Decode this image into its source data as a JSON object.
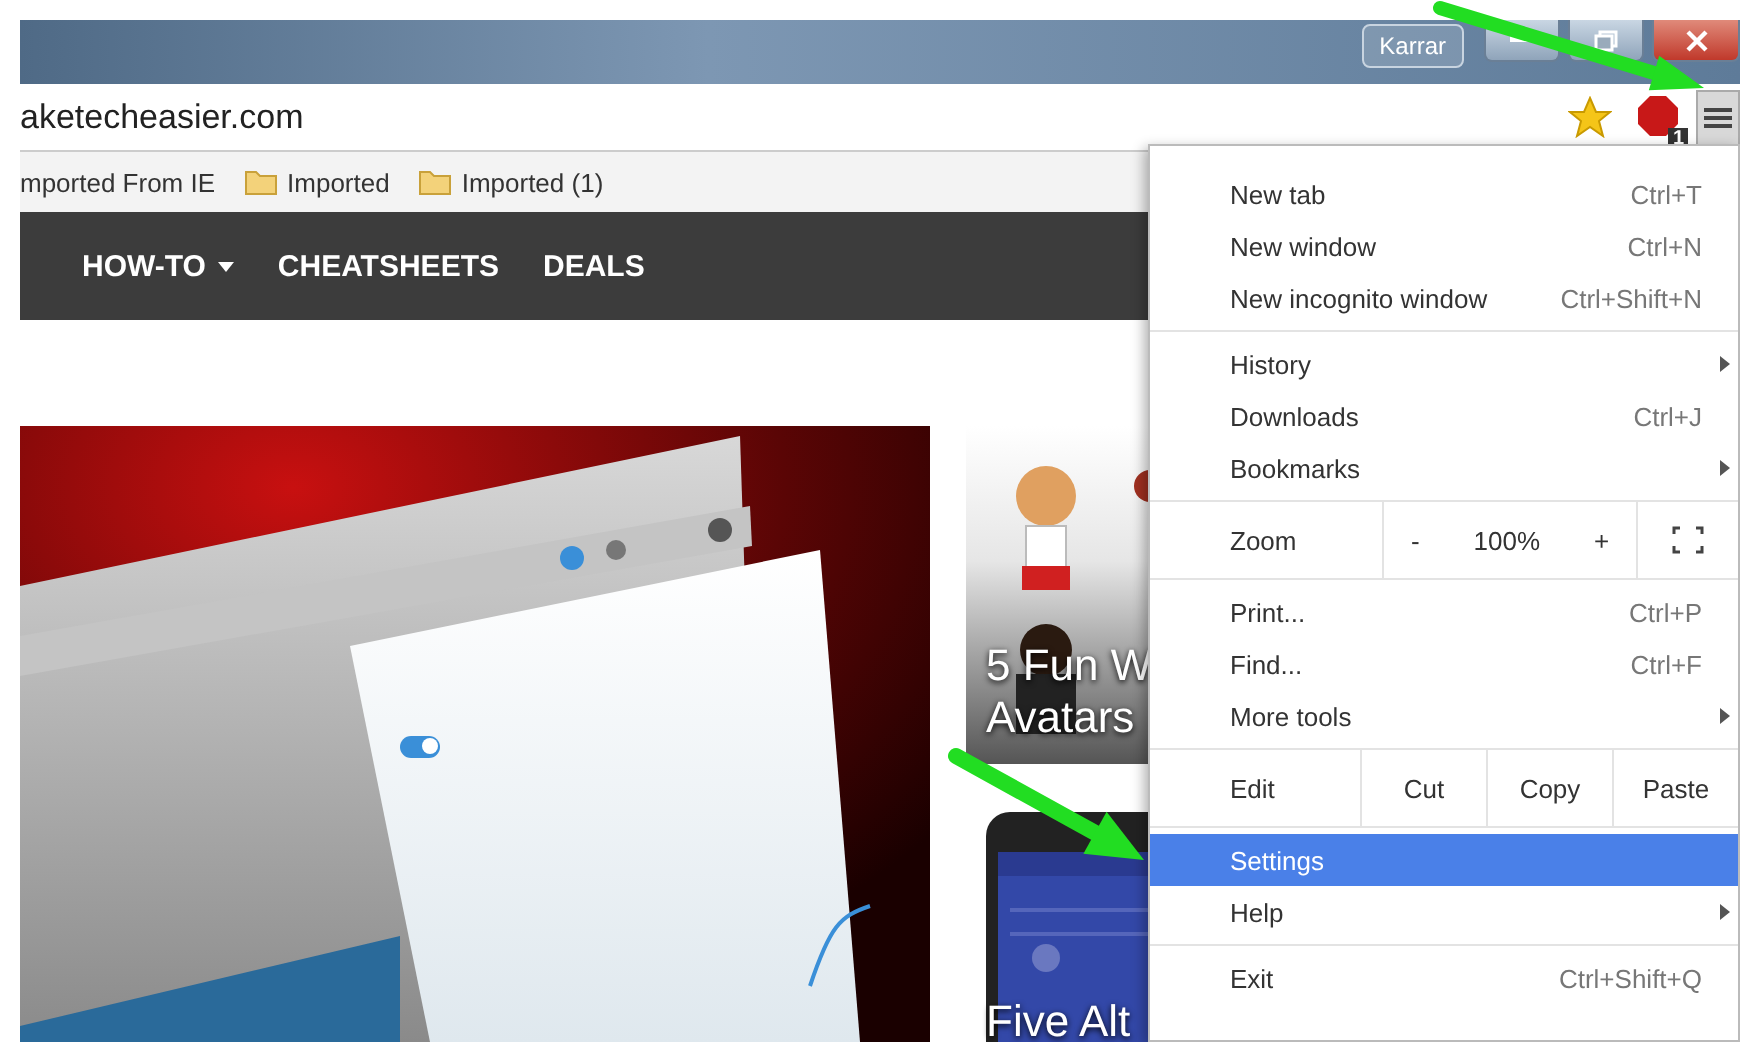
{
  "title_bar": {
    "user_button": "Karrar"
  },
  "address_bar": {
    "url": "aketecheasier.com",
    "extension_badge": "1",
    "menu_open": true
  },
  "bookmarks": [
    {
      "kind": "text",
      "label": "mported From IE"
    },
    {
      "kind": "folder",
      "label": "Imported"
    },
    {
      "kind": "folder",
      "label": "Imported (1)"
    }
  ],
  "nav": [
    {
      "label": "HOW-TO",
      "dropdown": true
    },
    {
      "label": "CHEATSHEETS",
      "dropdown": false
    },
    {
      "label": "DEALS",
      "dropdown": false
    }
  ],
  "tiles": [
    {
      "kind": "avatars",
      "headline": [
        "5 Fun W",
        "Avatars"
      ]
    },
    {
      "kind": "phone",
      "headline": [
        "Five Alt"
      ]
    }
  ],
  "menu": {
    "sections": [
      [
        {
          "kind": "item",
          "label": "New tab",
          "shortcut": "Ctrl+T",
          "submenu": false,
          "selected": false
        },
        {
          "kind": "item",
          "label": "New window",
          "shortcut": "Ctrl+N",
          "submenu": false,
          "selected": false
        },
        {
          "kind": "item",
          "label": "New incognito window",
          "shortcut": "Ctrl+Shift+N",
          "submenu": false,
          "selected": false
        }
      ],
      [
        {
          "kind": "item",
          "label": "History",
          "submenu": true,
          "selected": false
        },
        {
          "kind": "item",
          "label": "Downloads",
          "shortcut": "Ctrl+J",
          "submenu": false,
          "selected": false
        },
        {
          "kind": "item",
          "label": "Bookmarks",
          "submenu": true,
          "selected": false
        }
      ],
      [
        {
          "kind": "zoom",
          "label": "Zoom",
          "minus": "-",
          "value": "100%",
          "plus": "+"
        }
      ],
      [
        {
          "kind": "item",
          "label": "Print...",
          "shortcut": "Ctrl+P",
          "submenu": false,
          "selected": false
        },
        {
          "kind": "item",
          "label": "Find...",
          "shortcut": "Ctrl+F",
          "submenu": false,
          "selected": false
        },
        {
          "kind": "item",
          "label": "More tools",
          "submenu": true,
          "selected": false
        }
      ],
      [
        {
          "kind": "edit",
          "label": "Edit",
          "actions": [
            "Cut",
            "Copy",
            "Paste"
          ]
        },
        {
          "kind": "item",
          "label": "Settings",
          "submenu": false,
          "selected": true
        },
        {
          "kind": "item",
          "label": "Help",
          "submenu": true,
          "selected": false
        }
      ],
      [
        {
          "kind": "item",
          "label": "Exit",
          "shortcut": "Ctrl+Shift+Q",
          "submenu": false,
          "selected": false
        }
      ]
    ]
  }
}
